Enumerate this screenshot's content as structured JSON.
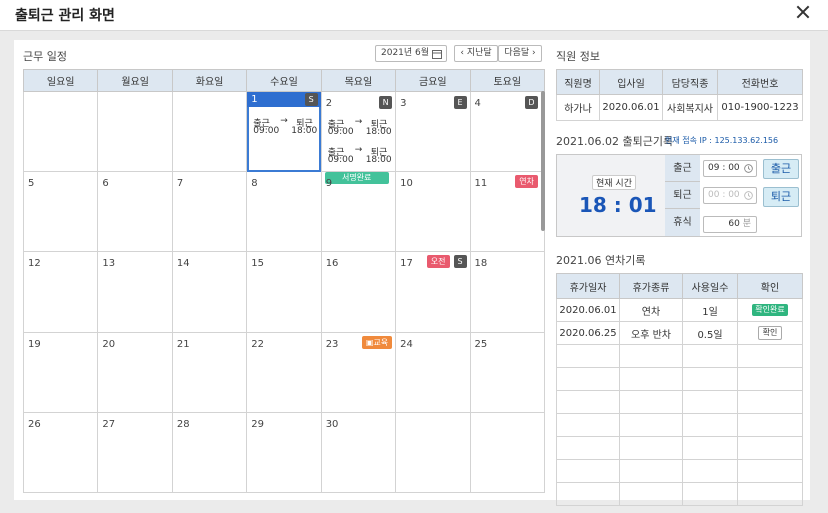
{
  "window": {
    "title": "출퇴근 관리 화면"
  },
  "schedule": {
    "section_title": "근무 일정",
    "month_selector": "2021년 6월",
    "prev_label": "지난달",
    "next_label": "다음달",
    "weekdays": [
      "일요일",
      "월요일",
      "화요일",
      "수요일",
      "목요일",
      "금요일",
      "토요일"
    ],
    "days": {
      "d1": "1",
      "d2": "2",
      "d3": "3",
      "d4": "4",
      "d5": "5",
      "d6": "6",
      "d7": "7",
      "d8": "8",
      "d9": "9",
      "d10": "10",
      "d11": "11",
      "d12": "12",
      "d13": "13",
      "d14": "14",
      "d15": "15",
      "d16": "16",
      "d17": "17",
      "d18": "18",
      "d19": "19",
      "d20": "20",
      "d21": "21",
      "d22": "22",
      "d23": "23",
      "d24": "24",
      "d25": "25",
      "d26": "26",
      "d27": "27",
      "d28": "28",
      "d29": "29",
      "d30": "30"
    },
    "shift_badges": {
      "d1": "S",
      "d2": "N",
      "d3": "E",
      "d4": "D",
      "d17": "S"
    },
    "event_badges": {
      "d11": "연차",
      "d17": "오전",
      "d23": "교육"
    },
    "attendance": {
      "in_label": "출근",
      "arrow": "→",
      "out_label": "퇴근",
      "d1_in": "09:00",
      "d1_out": "18:00",
      "d2a_in": "09:00",
      "d2a_out": "18:00",
      "d2b_in": "09:00",
      "d2b_out": "18:00"
    },
    "sign_status": "서명완료"
  },
  "employee": {
    "section_title": "직원 정보",
    "headers": [
      "직원명",
      "입사일",
      "담당직종",
      "전화번호"
    ],
    "values": [
      "하가나",
      "2020.06.01",
      "사회복지사",
      "010-1900-1223"
    ]
  },
  "commute": {
    "section_title": "2021.06.02 출퇴근기록",
    "ip_text": "현재 접속 IP : 125.133.62.156",
    "current_time_label": "현재 시간",
    "current_time": "18 : 01",
    "in_label": "출근",
    "in_value": "09 : 00",
    "out_label": "퇴근",
    "out_placeholder": "00 : 00",
    "rest_label": "휴식",
    "rest_value": "60",
    "rest_unit": "분",
    "in_button": "출근",
    "out_button": "퇴근"
  },
  "leave": {
    "section_title": "2021.06 연차기록",
    "headers": [
      "휴가일자",
      "휴가종류",
      "사용일수",
      "확인"
    ],
    "rows": [
      [
        "2020.06.01",
        "연차",
        "1일",
        "확인완료"
      ],
      [
        "2020.06.25",
        "오후 반차",
        "0.5일",
        "확인"
      ]
    ]
  },
  "colors": {
    "accent": "#2e6ed0",
    "header_bg": "#dde7f1",
    "green": "#43c29a",
    "red_badge": "#e95a6e",
    "orange_badge": "#f08a3c"
  }
}
